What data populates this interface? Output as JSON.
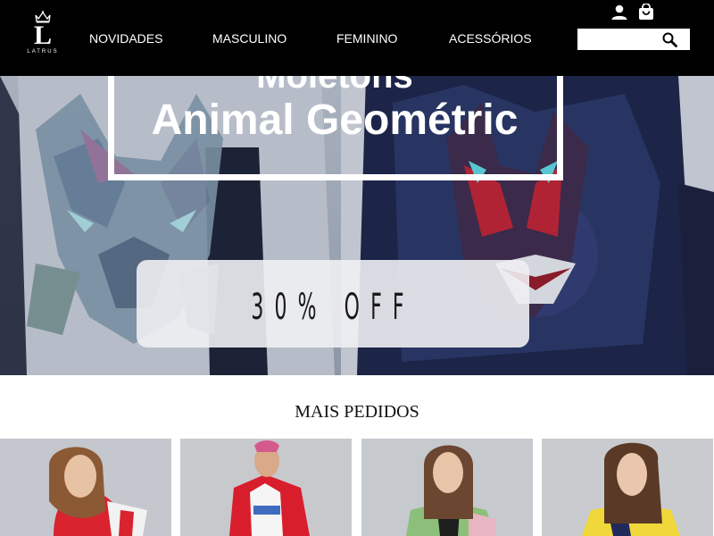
{
  "header": {
    "brand_letter": "L",
    "brand_name": "LATRUS",
    "nav": [
      {
        "label": "NOVIDADES"
      },
      {
        "label": "MASCULINO"
      },
      {
        "label": "FEMININO"
      },
      {
        "label": "ACESSÓRIOS"
      }
    ],
    "search_placeholder": "",
    "icons": [
      "user-icon",
      "shopping-bag-icon",
      "search-icon"
    ]
  },
  "hero": {
    "headline_top": "Moletons",
    "headline": "Animal Geométric",
    "discount": "30% OFF"
  },
  "section": {
    "title": "MAIS PEDIDOS",
    "products": [
      {
        "name": "product-1",
        "accent": "#d9232e"
      },
      {
        "name": "product-2",
        "accent": "#d81e2c"
      },
      {
        "name": "product-3",
        "accent": "#8cbf7a"
      },
      {
        "name": "product-4",
        "accent": "#f0d83a"
      }
    ]
  },
  "colors": {
    "header_bg": "#000000",
    "header_text": "#ffffff",
    "page_bg": "#ffffff"
  }
}
